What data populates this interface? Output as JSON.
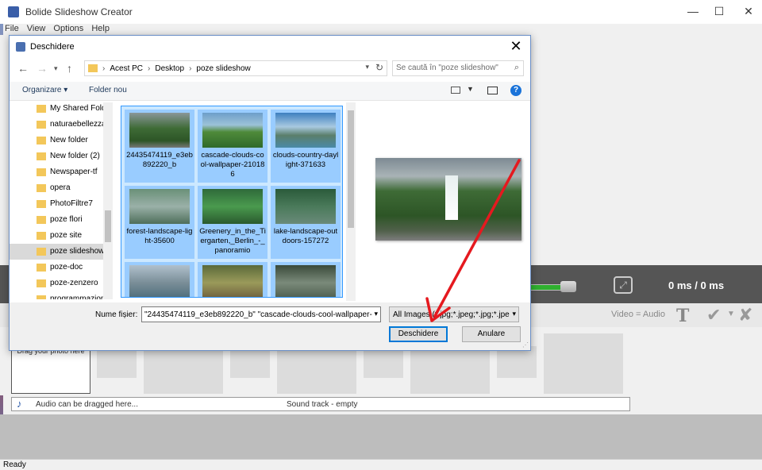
{
  "app": {
    "title": "Bolide Slideshow Creator",
    "menu": [
      "File",
      "View",
      "Options",
      "Help"
    ],
    "window_controls": {
      "minimize": "—",
      "maximize": "☐",
      "close": "✕"
    },
    "preview": {
      "time": "0 ms  / 0 ms"
    },
    "timeline_toolbar": {
      "video_audio": "Video = Audio"
    },
    "drag_photo": "Drag your photo here",
    "audio_hint": "Audio can be dragged here...",
    "sound_track": "Sound track - empty",
    "status": "Ready"
  },
  "dialog": {
    "title": "Deschidere",
    "close": "✕",
    "breadcrumb": [
      "Acest PC",
      "Desktop",
      "poze slideshow"
    ],
    "search_placeholder": "Se caută în \"poze slideshow\"",
    "organize": "Organizare ▾",
    "new_folder": "Folder nou",
    "help": "?",
    "nav_items": [
      {
        "label": "My Shared Fold"
      },
      {
        "label": "naturaebellezza"
      },
      {
        "label": "New folder"
      },
      {
        "label": "New folder (2)"
      },
      {
        "label": "Newspaper-tf"
      },
      {
        "label": "opera"
      },
      {
        "label": "PhotoFiltre7"
      },
      {
        "label": "poze flori"
      },
      {
        "label": "poze site"
      },
      {
        "label": "poze slideshow",
        "selected": true
      },
      {
        "label": "poze-doc"
      },
      {
        "label": "poze-zenzero"
      },
      {
        "label": "programmazione"
      }
    ],
    "files": [
      {
        "name": "24435474119_e3eb892220_b"
      },
      {
        "name": "cascade-clouds-cool-wallpaper-210186"
      },
      {
        "name": "clouds-country-daylight-371633"
      },
      {
        "name": "forest-landscape-light-35600"
      },
      {
        "name": "Greenery_in_the_Tiergarten,_Berlin_-_panoramio"
      },
      {
        "name": "lake-landscape-outdoors-157272"
      },
      {
        "name": ""
      },
      {
        "name": ""
      },
      {
        "name": ""
      }
    ],
    "filename_label": "Nume fișier:",
    "filename_value": "\"24435474119_e3eb892220_b\" \"cascade-clouds-cool-wallpaper-",
    "filter_value": "All Images (*.jpg;*.jpeg;*.jpg;*.jpe",
    "open_button": "Deschidere",
    "cancel_button": "Anulare"
  },
  "colors": {
    "accent": "#0078d7",
    "selection": "#cce8ff",
    "arrow": "#e5191f"
  }
}
